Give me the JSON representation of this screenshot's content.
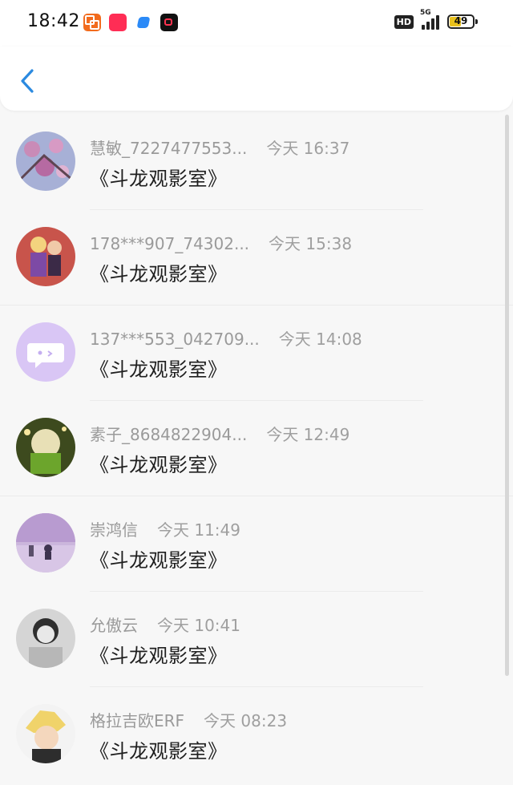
{
  "status_bar": {
    "time": "18:42",
    "hd": "HD",
    "network": "5G",
    "battery": "49"
  },
  "header": {
    "back_icon": "chevron-left-icon",
    "accent": "#2b8ae0"
  },
  "messages": [
    {
      "name": "慧敏_7227477553...",
      "time": "今天 16:37",
      "text": "《斗龙观影室》"
    },
    {
      "name": "178***907_74302...",
      "time": "今天 15:38",
      "text": "《斗龙观影室》"
    },
    {
      "name": "137***553_042709...",
      "time": "今天 14:08",
      "text": "《斗龙观影室》"
    },
    {
      "name": "素子_8684822904...",
      "time": "今天 12:49",
      "text": "《斗龙观影室》"
    },
    {
      "name": "崇鸿信",
      "time": "今天 11:49",
      "text": "《斗龙观影室》"
    },
    {
      "name": "允傲云",
      "time": "今天 10:41",
      "text": "《斗龙观影室》"
    },
    {
      "name": "格拉吉欧ERF",
      "time": "今天 08:23",
      "text": "《斗龙观影室》"
    }
  ]
}
